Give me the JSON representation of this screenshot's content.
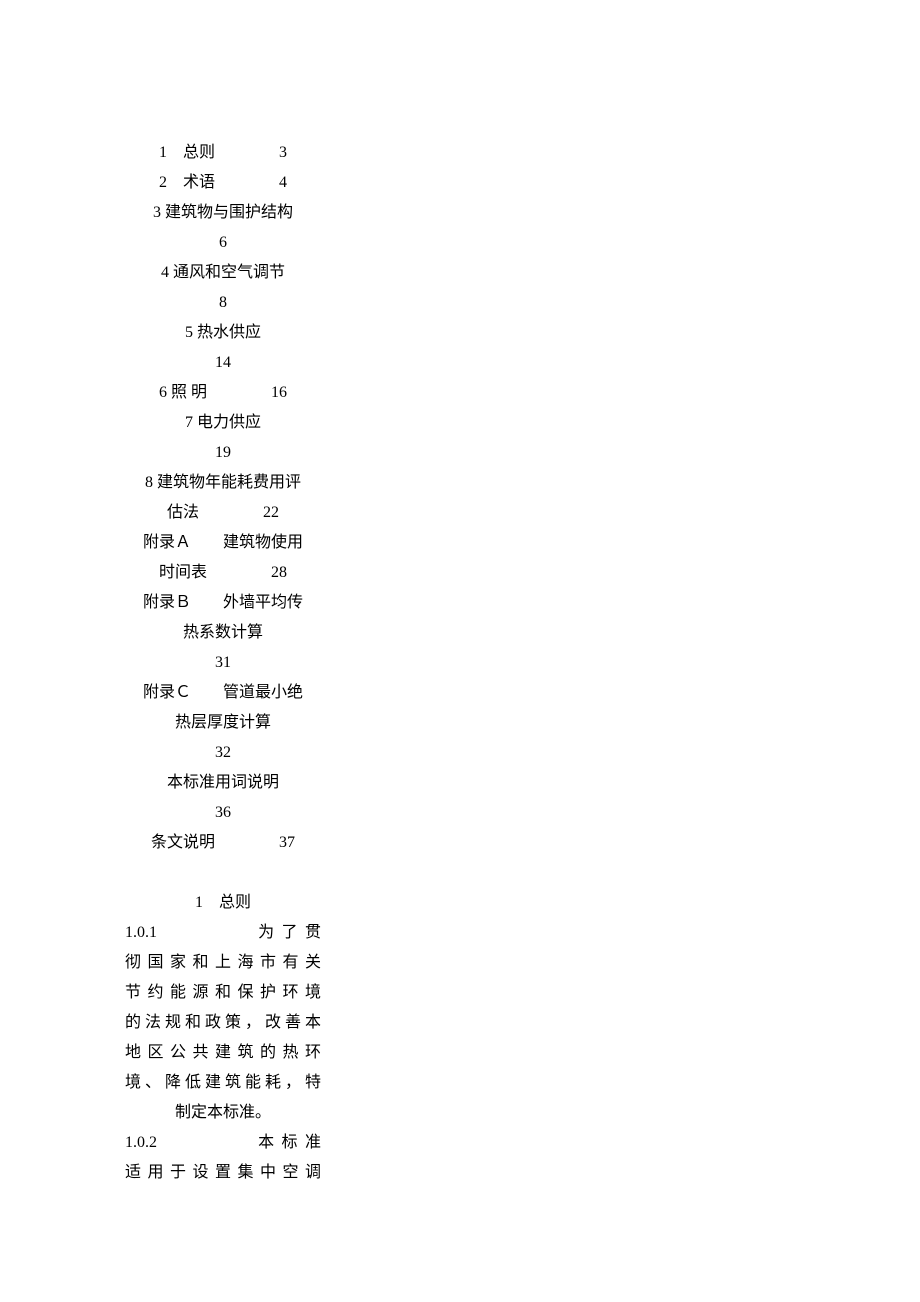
{
  "toc": [
    {
      "line": "1　总则　　　　3"
    },
    {
      "line": "2　术语　　　　4"
    },
    {
      "line": "3 建筑物与围护结构"
    },
    {
      "line": "6"
    },
    {
      "line": "4 通风和空气调节"
    },
    {
      "line": "8"
    },
    {
      "line": "5 热水供应"
    },
    {
      "line": "14"
    },
    {
      "line": "6 照 明　　　　16"
    },
    {
      "line": "7 电力供应"
    },
    {
      "line": "19"
    },
    {
      "line": "8 建筑物年能耗费用评"
    },
    {
      "line": "估法　　　　22"
    },
    {
      "line": "附录Ａ　　建筑物使用"
    },
    {
      "line": "时间表　　　　28"
    },
    {
      "line": "附录Ｂ　　外墙平均传"
    },
    {
      "line": "热系数计算"
    },
    {
      "line": "31"
    },
    {
      "line": "附录Ｃ　　管道最小绝"
    },
    {
      "line": "热层厚度计算"
    },
    {
      "line": "32"
    },
    {
      "line": "本标准用词说明"
    },
    {
      "line": "36"
    },
    {
      "line": "条文说明　　　　37"
    }
  ],
  "section": {
    "heading": "1　总则",
    "p1_a": "1.0.1　　　　为了贯",
    "p1_b": "彻国家和上海市有关",
    "p1_c": "节约能源和保护环境",
    "p1_d": "的法规和政策，改善本",
    "p1_e": "地区公共建筑的热环",
    "p1_f": "境、降低建筑能耗，特",
    "p1_g": "制定本标准。",
    "p2_a": "1.0.2　　　　本标准",
    "p2_b": "适用于设置集中空调"
  }
}
